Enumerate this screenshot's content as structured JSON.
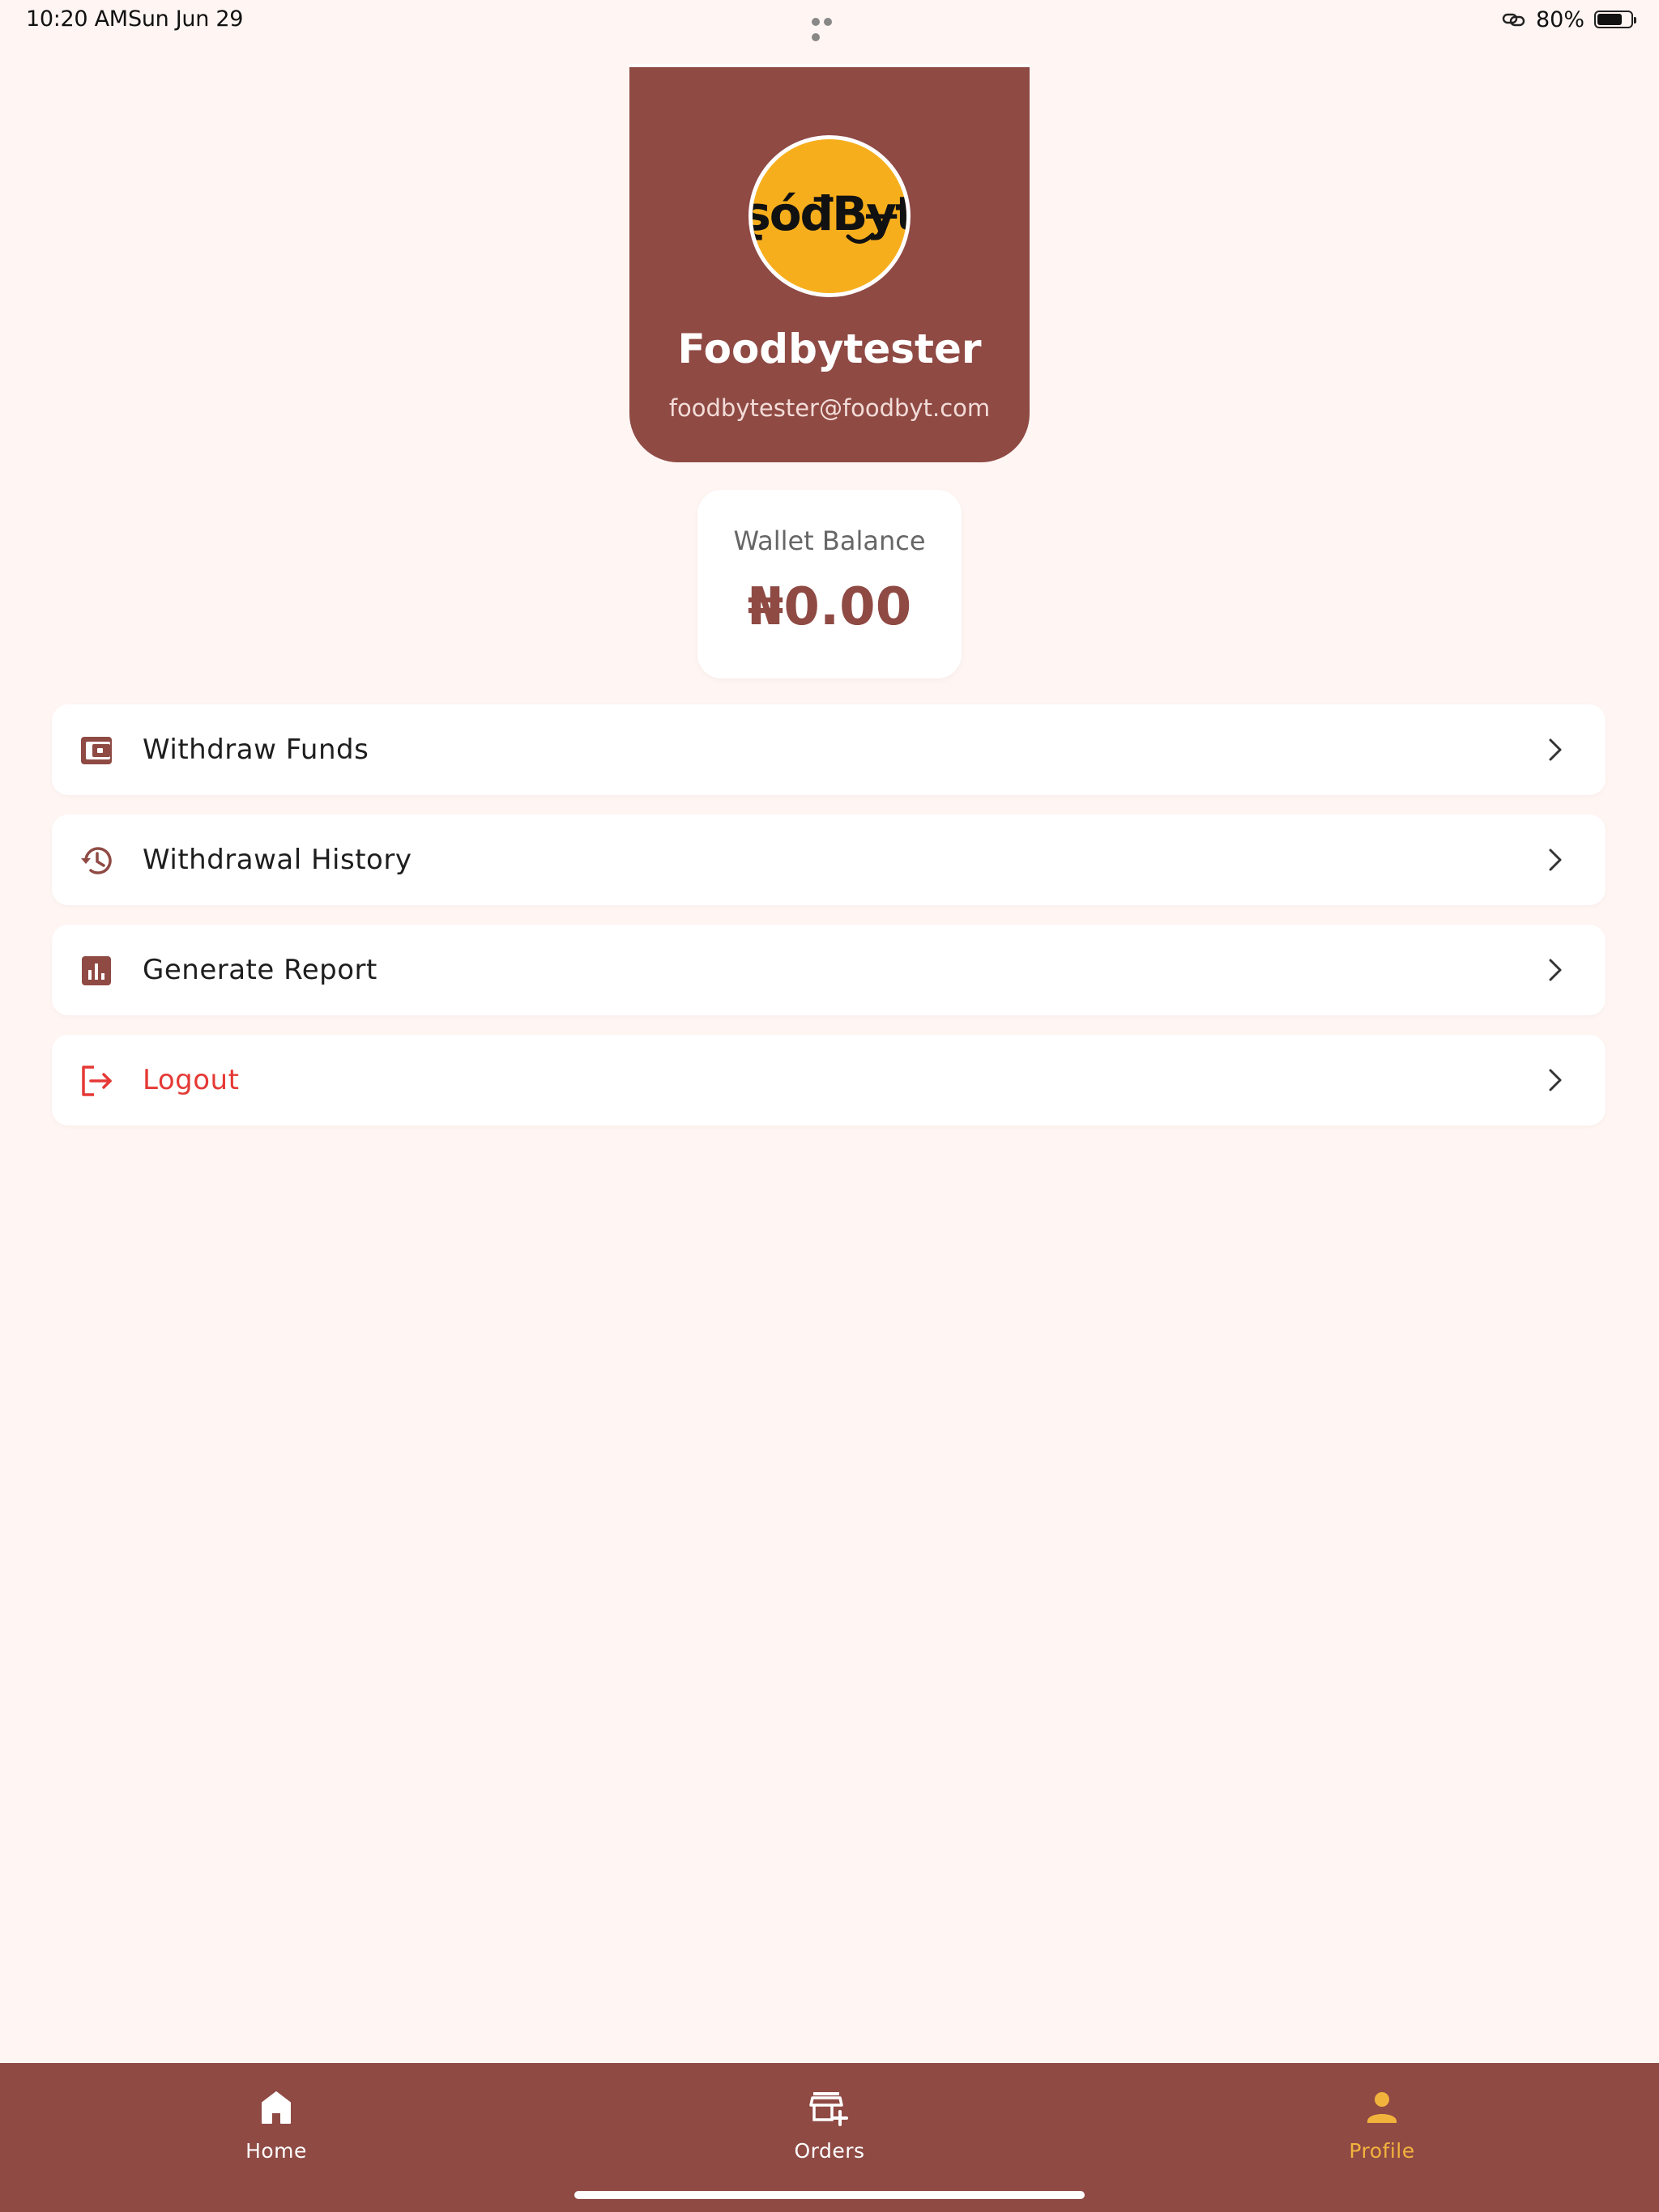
{
  "status_bar": {
    "time": "10:20 AM",
    "date": "Sun Jun 29",
    "battery_text": "80%",
    "battery_level": 0.8,
    "link_icon": "link-icon"
  },
  "profile": {
    "logo_text": "ʂóđBɏt",
    "name": "Foodbytester",
    "email": "foodbytester@foodbyt.com"
  },
  "wallet": {
    "label": "Wallet Balance",
    "amount": "₦0.00"
  },
  "menu": {
    "items": [
      {
        "label": "Withdraw Funds",
        "icon": "wallet-icon"
      },
      {
        "label": "Withdrawal History",
        "icon": "history-icon"
      },
      {
        "label": "Generate Report",
        "icon": "bar-chart-icon"
      },
      {
        "label": "Logout",
        "icon": "logout-icon"
      }
    ]
  },
  "bottom_nav": {
    "items": [
      {
        "label": "Home",
        "icon": "home-icon",
        "active": false
      },
      {
        "label": "Orders",
        "icon": "store-add-icon",
        "active": false
      },
      {
        "label": "Profile",
        "icon": "person-icon",
        "active": true
      }
    ]
  },
  "colors": {
    "brand": "#8F4A44",
    "accent": "#F2B33D",
    "logout": "#E53935",
    "background": "#FFF5F3"
  }
}
